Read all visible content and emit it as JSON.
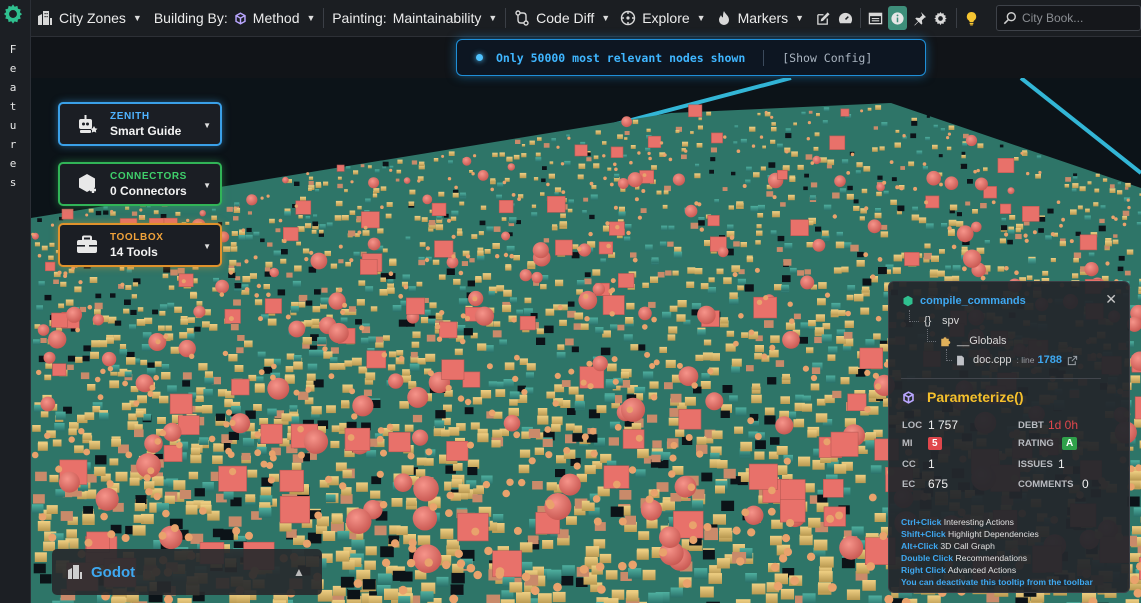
{
  "sidebar": {
    "vertical_label": "F e a t u r e s"
  },
  "toolbar": {
    "city_zones": "City Zones",
    "building_by_label": "Building By:",
    "building_by_value": "Method",
    "painting_label": "Painting:",
    "painting_value": "Maintainability",
    "code_diff": "Code Diff",
    "explore": "Explore",
    "markers": "Markers",
    "search_placeholder": "City Book..."
  },
  "banner": {
    "message": "Only 50000 most relevant nodes shown",
    "config_link": "[Show Config]"
  },
  "panels": {
    "zenith": {
      "title": "ZENITH",
      "subtitle": "Smart Guide"
    },
    "connectors": {
      "title": "CONNECTORS",
      "subtitle": "0 Connectors"
    },
    "toolbox": {
      "title": "TOOLBOX",
      "subtitle": "14 Tools"
    }
  },
  "project": {
    "name": "Godot"
  },
  "tooltip": {
    "path": {
      "root": "compile_commands",
      "namespace": "spv",
      "scope": "__Globals",
      "file": "doc.cpp",
      "line_label": ": line",
      "line_number": "1788"
    },
    "function_name": "Parameterize()",
    "metrics": {
      "loc_label": "LOC",
      "loc_value": "1 757",
      "mi_label": "MI",
      "mi_value": "5",
      "cc_label": "CC",
      "cc_value": "1",
      "ec_label": "EC",
      "ec_value": "675",
      "debt_label": "DEBT",
      "debt_value": "1d 0h",
      "rating_label": "RATING",
      "rating_value": "A",
      "issues_label": "ISSUES",
      "issues_value": "1",
      "comments_label": "COMMENTS",
      "comments_value": "0"
    },
    "hints": [
      {
        "key": "Ctrl+Click",
        "text": "Interesting Actions"
      },
      {
        "key": "Shift+Click",
        "text": "Highlight Dependencies"
      },
      {
        "key": "Alt+Click",
        "text": "3D Call Graph"
      },
      {
        "key": "Double Click",
        "text": "Recommendations"
      },
      {
        "key": "Right Click",
        "text": "Advanced Actions"
      }
    ],
    "footer": "You can deactivate this tooltip from the toolbar"
  },
  "colors": {
    "accent_blue": "#3ea8f0",
    "building_red": "#e8716a",
    "building_yellow": "#e2c270",
    "building_teal": "#3b9b8f",
    "function_gold": "#f5c02c",
    "rating_green": "#2fa04a",
    "mi_red": "#e0474c"
  }
}
